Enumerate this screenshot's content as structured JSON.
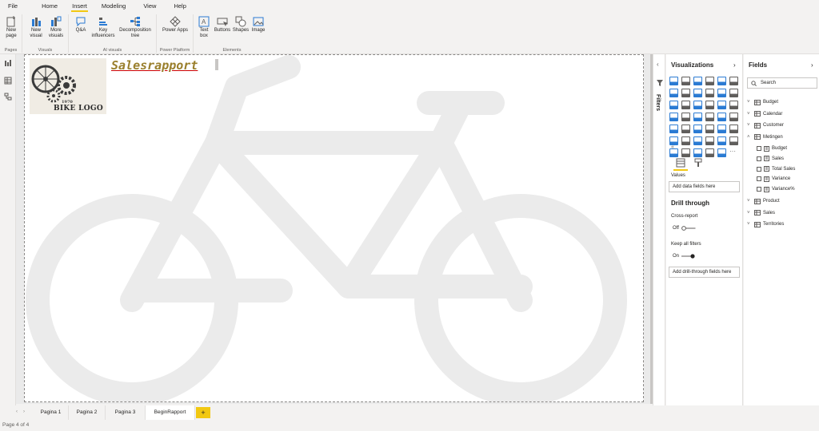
{
  "menu_tabs": [
    "File",
    "Home",
    "Insert",
    "Modeling",
    "View",
    "Help"
  ],
  "ribbon": {
    "pages_group": {
      "new_page": "New page",
      "label": "Pages"
    },
    "visuals_group": {
      "new_visual": "New visual",
      "more_visuals": "More visuals",
      "label": "Visuals"
    },
    "ai_group": {
      "qa": "Q&A",
      "key_influencers": "Key influencers",
      "decomposition_tree": "Decomposition tree",
      "label": "AI visuals"
    },
    "power_group": {
      "power_apps": "Power Apps",
      "label": "Power Platform"
    },
    "elements_group": {
      "text_box": "Text box",
      "buttons": "Buttons",
      "shapes": "Shapes",
      "image": "Image",
      "label": "Elements"
    }
  },
  "report": {
    "title": "Salesrapport",
    "logo_year": "1970",
    "logo_text": "BIKE LOGO"
  },
  "filters_label": "Filters",
  "visualizations": {
    "title": "Visualizations",
    "values_label": "Values",
    "values_placeholder": "Add data fields here",
    "drill_title": "Drill through",
    "cross_report": "Cross-report",
    "cross_report_state": "Off",
    "keep_filters": "Keep all filters",
    "keep_filters_state": "On",
    "drill_placeholder": "Add drill-through fields here",
    "more_label": "···",
    "chevron": "«"
  },
  "fields": {
    "title": "Fields",
    "search_placeholder": "Search",
    "tables": [
      "Budget",
      "Calendar",
      "Customer",
      "Metingen",
      "Product",
      "Sales",
      "Territories"
    ],
    "metingen_fields": [
      "Budget",
      "Sales",
      "Total Sales",
      "Variance",
      "Variance%"
    ]
  },
  "page_tabs": [
    "Pagina 1",
    "Pagina 2",
    "Pagina 3",
    "BeginRapport"
  ],
  "add_page": "+",
  "status": "Page 4 of 4",
  "colors": {
    "accent": "#f2c811",
    "bike_gray": "#ebebeb",
    "visual_blue": "#2b7bd3"
  }
}
